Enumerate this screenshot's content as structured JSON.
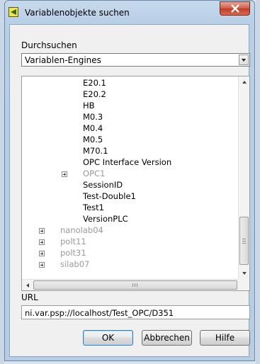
{
  "window": {
    "title": "Variablenobjekte suchen"
  },
  "browse": {
    "label": "Durchsuchen",
    "selected": "Variablen-Engines"
  },
  "tree": {
    "children": [
      "E20.1",
      "E20.2",
      "HB",
      "M0.3",
      "M0.4",
      "M0.5",
      "M70.1",
      "OPC Interface Version"
    ],
    "opc1": "OPC1",
    "children2": [
      "SessionID",
      "Test-Double1",
      "Test1",
      "VersionPLC"
    ],
    "hosts": [
      "nanolab04",
      "polt11",
      "polt31",
      "silab07"
    ]
  },
  "url": {
    "label": "URL",
    "value": "ni.var.psp://localhost/Test_OPC/D351"
  },
  "buttons": {
    "ok": "OK",
    "cancel": "Abbrechen",
    "help": "Hilfe"
  },
  "colors": {
    "accent": "#3c7fb1",
    "disabled_text": "#9a9a9a"
  }
}
